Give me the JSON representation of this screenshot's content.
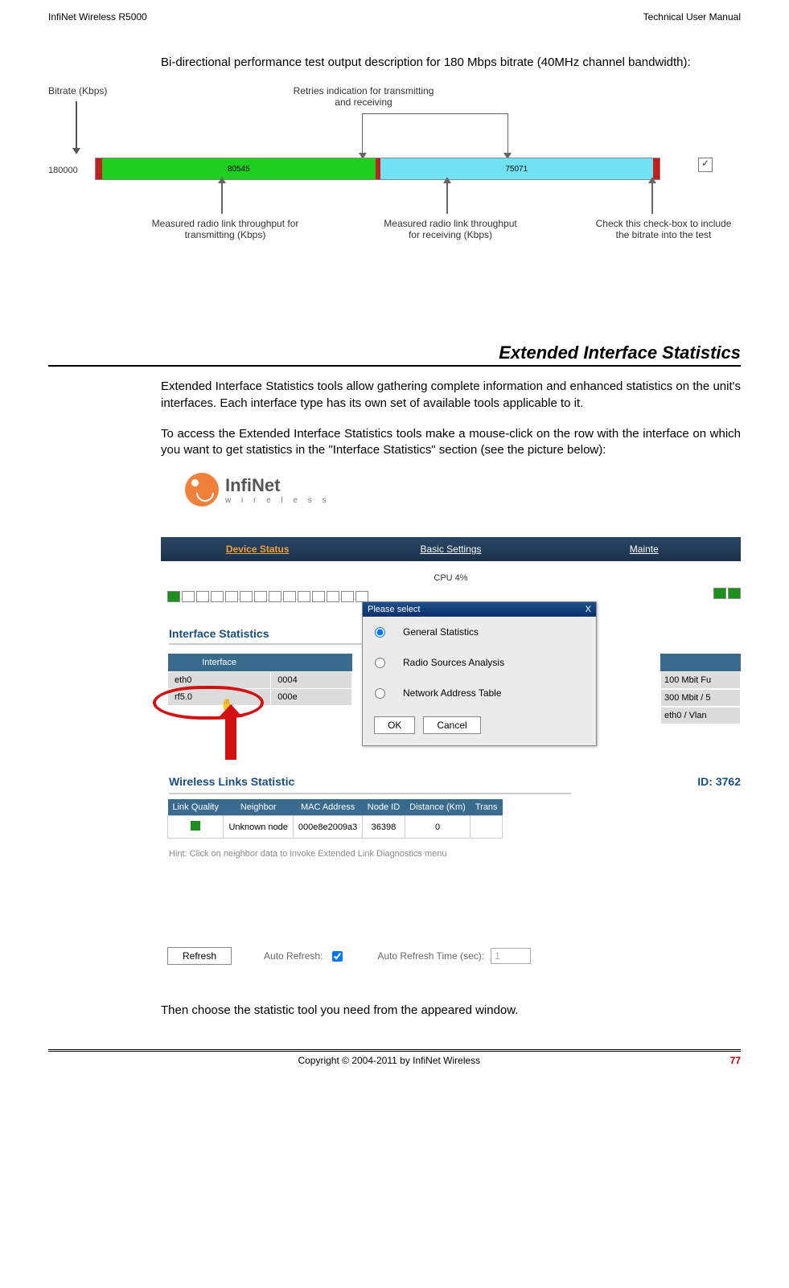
{
  "header": {
    "left": "InfiNet Wireless R5000",
    "right": "Technical User Manual"
  },
  "intro": "Bi-directional performance test output description for 180 Mbps bitrate (40MHz channel bandwidth):",
  "diag1": {
    "bitrate_label": "Bitrate (Kbps)",
    "top_label": "Retries indication for transmitting and receiving",
    "bitrate_value": "180000",
    "bar_tx": "80545",
    "bar_rx": "75071",
    "bot_tx": "Measured radio link throughput for transmitting (Kbps)",
    "bot_rx": "Measured radio link throughput for receiving (Kbps)",
    "bot_chk": "Check this check-box to include the bitrate into the test"
  },
  "section_title": "Extended Interface Statistics",
  "para1": "Extended Interface Statistics tools allow gathering complete information and enhanced statistics on the unit's interfaces. Each interface type has its own set of available tools applicable to it.",
  "para2": "To access the Extended Interface Statistics tools make a mouse-click on the row with the interface on which you want to get statistics in the \"Interface Statistics\" section (see the picture below):",
  "logo": {
    "big": "InfiNet",
    "small": "w i r e l e s s"
  },
  "tabs": {
    "a": "Device Status",
    "b": "Basic Settings",
    "c": "Mainte"
  },
  "cpu": "CPU 4%",
  "popup": {
    "title": "Please select",
    "close": "X",
    "opt1": "General Statistics",
    "opt2": "Radio Sources Analysis",
    "opt3": "Network Address Table",
    "ok": "OK",
    "cancel": "Cancel"
  },
  "iface": {
    "title": "Interface Statistics",
    "col1": "Interface",
    "r1a": "eth0",
    "r1b": "0004",
    "r2a": "rf5.0",
    "r2b": "000e"
  },
  "rightcol": {
    "r1": "100 Mbit Fu",
    "r2": "300 Mbit / 5",
    "r3": "eth0 / Vlan"
  },
  "wls": {
    "title": "Wireless Links Statistic",
    "rid": "ID: 3762",
    "h1": "Link Quality",
    "h2": "Neighbor",
    "h3": "MAC Address",
    "h4": "Node ID",
    "h5": "Distance (Km)",
    "h6": "Trans",
    "neighbor": "Unknown node",
    "mac": "000e8e2009a3",
    "node": "36398",
    "dist": "0"
  },
  "hint": "Hint: Click on neighbor data to invoke Extended Link Diagnostics menu",
  "bottom": {
    "refresh": "Refresh",
    "auto": "Auto Refresh:",
    "time_lbl": "Auto Refresh Time (sec):",
    "time_val": "1"
  },
  "closing": "Then choose the statistic tool you need from the appeared window.",
  "footer": {
    "copy": "Copyright © 2004-2011 by InfiNet Wireless",
    "page": "77"
  }
}
